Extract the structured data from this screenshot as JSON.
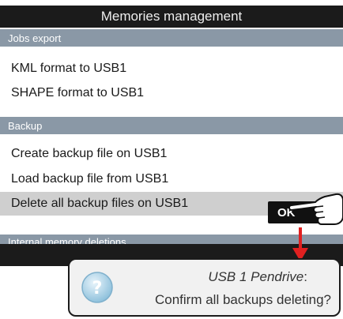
{
  "window": {
    "title": "Memories management"
  },
  "sections": {
    "jobs_export": {
      "header": "Jobs export",
      "items": [
        "KML format to USB1",
        "SHAPE format to USB1"
      ]
    },
    "backup": {
      "header": "Backup",
      "items": [
        "Create backup file on USB1",
        "Load backup file from USB1",
        "Delete all backup files on USB1"
      ]
    },
    "internal": {
      "header": "Internal memory deletions"
    }
  },
  "ok_button": {
    "label": "OK"
  },
  "dialog": {
    "title": "USB 1 Pendrive",
    "title_suffix": ":",
    "message": "Confirm all backups deleting?",
    "icon": "question-icon"
  },
  "colors": {
    "titlebar": "#1b1b1b",
    "section_header": "#8a98a6",
    "selected_row": "#cfcfcf",
    "arrow": "#e02020"
  }
}
